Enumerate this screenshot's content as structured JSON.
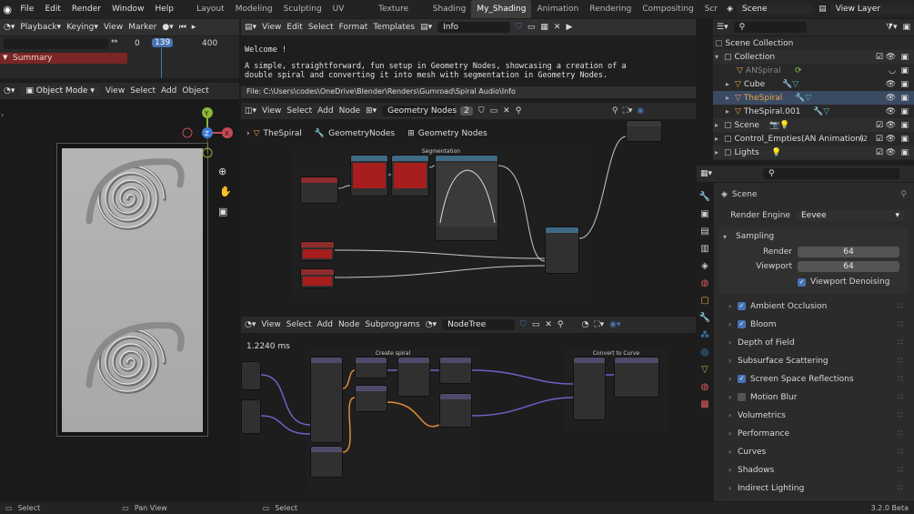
{
  "topbar": {
    "menus": [
      "File",
      "Edit",
      "Render",
      "Window",
      "Help"
    ],
    "workspaces": [
      "Layout",
      "Modeling",
      "Sculpting",
      "UV Editing",
      "Texture Paint",
      "Shading",
      "My_Shading",
      "Animation",
      "Rendering",
      "Compositing",
      "Scr"
    ],
    "active_workspace": "My_Shading",
    "scene": "Scene",
    "view_layer": "View Layer"
  },
  "timeline": {
    "menus": [
      "Playback",
      "Keying",
      "View",
      "Marker"
    ],
    "frame_labels": [
      "0",
      "139",
      "400"
    ],
    "current_frame": "139"
  },
  "dopesheet": {
    "summary": "Summary"
  },
  "viewport": {
    "mode": "Object Mode",
    "menus": [
      "View",
      "Select",
      "Add",
      "Object"
    ],
    "axes": {
      "x": "X",
      "y": "Y",
      "z": "Z"
    }
  },
  "info_editor": {
    "menus": [
      "View",
      "Edit",
      "Select",
      "Format",
      "Templates"
    ],
    "name": "Info",
    "lines": [
      "Welcome !",
      "A simple, straightforward, fun setup in Geometry Nodes, showcasing a creation of a",
      "double spiral and converting it into mesh with segmentation in Geometry Nodes."
    ],
    "file_path": "File: C:\\Users\\codes\\OneDrive\\Blender\\Renders\\Gumroad\\Spiral Audio\\Info"
  },
  "geo_nodes": {
    "menus": [
      "View",
      "Select",
      "Add",
      "Node"
    ],
    "tree": "Geometry Nodes",
    "users": "2",
    "breadcrumb": [
      "TheSpiral",
      "GeometryNodes",
      "Geometry Nodes"
    ],
    "frame_label": "Segmentation"
  },
  "node_tree": {
    "menus": [
      "View",
      "Select",
      "Add",
      "Node",
      "Subprograms"
    ],
    "tree": "NodeTree",
    "timing": "1.2240 ms",
    "frames": [
      "Create spiral",
      "Convert to Curve"
    ]
  },
  "outliner": {
    "items": [
      {
        "label": "Scene Collection",
        "indent": 0
      },
      {
        "label": "Collection",
        "indent": 1
      },
      {
        "label": "ANSpiral",
        "indent": 2
      },
      {
        "label": "Cube",
        "indent": 2
      },
      {
        "label": "TheSpiral",
        "indent": 2
      },
      {
        "label": "TheSpiral.001",
        "indent": 2
      },
      {
        "label": "Scene",
        "indent": 1
      },
      {
        "label": "Control_Empties(AN Animation)",
        "indent": 1
      },
      {
        "label": "Lights",
        "indent": 1
      }
    ],
    "control_count": "2"
  },
  "properties": {
    "context": "Scene",
    "render_engine_label": "Render Engine",
    "render_engine": "Eevee",
    "sampling": "Sampling",
    "render_label": "Render",
    "render_value": "64",
    "viewport_label": "Viewport",
    "viewport_value": "64",
    "denoise": "Viewport Denoising",
    "panels": [
      {
        "label": "Ambient Occlusion",
        "check": true
      },
      {
        "label": "Bloom",
        "check": true
      },
      {
        "label": "Depth of Field",
        "check": null
      },
      {
        "label": "Subsurface Scattering",
        "check": null
      },
      {
        "label": "Screen Space Reflections",
        "check": true
      },
      {
        "label": "Motion Blur",
        "check": false
      },
      {
        "label": "Volumetrics",
        "check": null
      },
      {
        "label": "Performance",
        "check": null
      },
      {
        "label": "Curves",
        "check": null
      },
      {
        "label": "Shadows",
        "check": null
      },
      {
        "label": "Indirect Lighting",
        "check": null
      }
    ]
  },
  "status": {
    "left": "Select",
    "middle": "Pan View",
    "right": "Select",
    "version": "3.2.0 Beta"
  },
  "colors": {
    "accent": "#4772b3",
    "active_obj": "#f0a346",
    "header": "#303030",
    "panel": "#2b2b2b"
  }
}
